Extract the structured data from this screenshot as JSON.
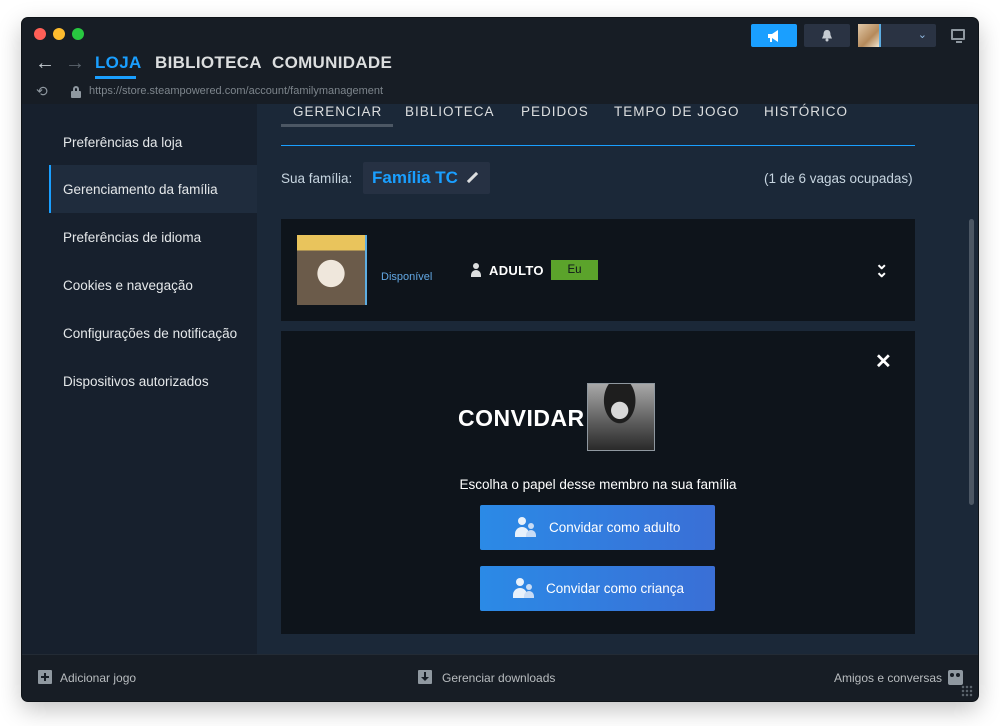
{
  "window": {
    "nav": {
      "loja": "LOJA",
      "biblioteca": "BIBLIOTECA",
      "comunidade": "COMUNIDADE"
    },
    "url": "https://store.steampowered.com/account/familymanagement"
  },
  "sidebar": {
    "items": [
      {
        "label": "Preferências da loja"
      },
      {
        "label": "Gerenciamento da família"
      },
      {
        "label": "Preferências de idioma"
      },
      {
        "label": "Cookies e navegação"
      },
      {
        "label": "Configurações de notificação"
      },
      {
        "label": "Dispositivos autorizados"
      }
    ],
    "active_index": 1
  },
  "tabs": [
    {
      "label": "GERENCIAR"
    },
    {
      "label": "BIBLIOTECA"
    },
    {
      "label": "PEDIDOS"
    },
    {
      "label": "TEMPO DE JOGO"
    },
    {
      "label": "HISTÓRICO"
    }
  ],
  "family": {
    "label": "Sua família:",
    "name": "Família TC",
    "slots": "(1 de 6 vagas ocupadas)"
  },
  "member": {
    "status": "Disponível",
    "role": "ADULTO",
    "badge": "Eu"
  },
  "invite": {
    "title": "CONVIDAR",
    "subtitle": "Escolha o papel desse membro na sua família",
    "adult_button": "Convidar como adulto",
    "child_button": "Convidar como criança"
  },
  "bottombar": {
    "add_game": "Adicionar jogo",
    "downloads": "Gerenciar downloads",
    "friends": "Amigos e conversas"
  },
  "colors": {
    "accent": "#1a9fff",
    "badge_green": "#5ba32b",
    "panel_bg": "#0e141b",
    "content_bg": "#1b2838"
  }
}
